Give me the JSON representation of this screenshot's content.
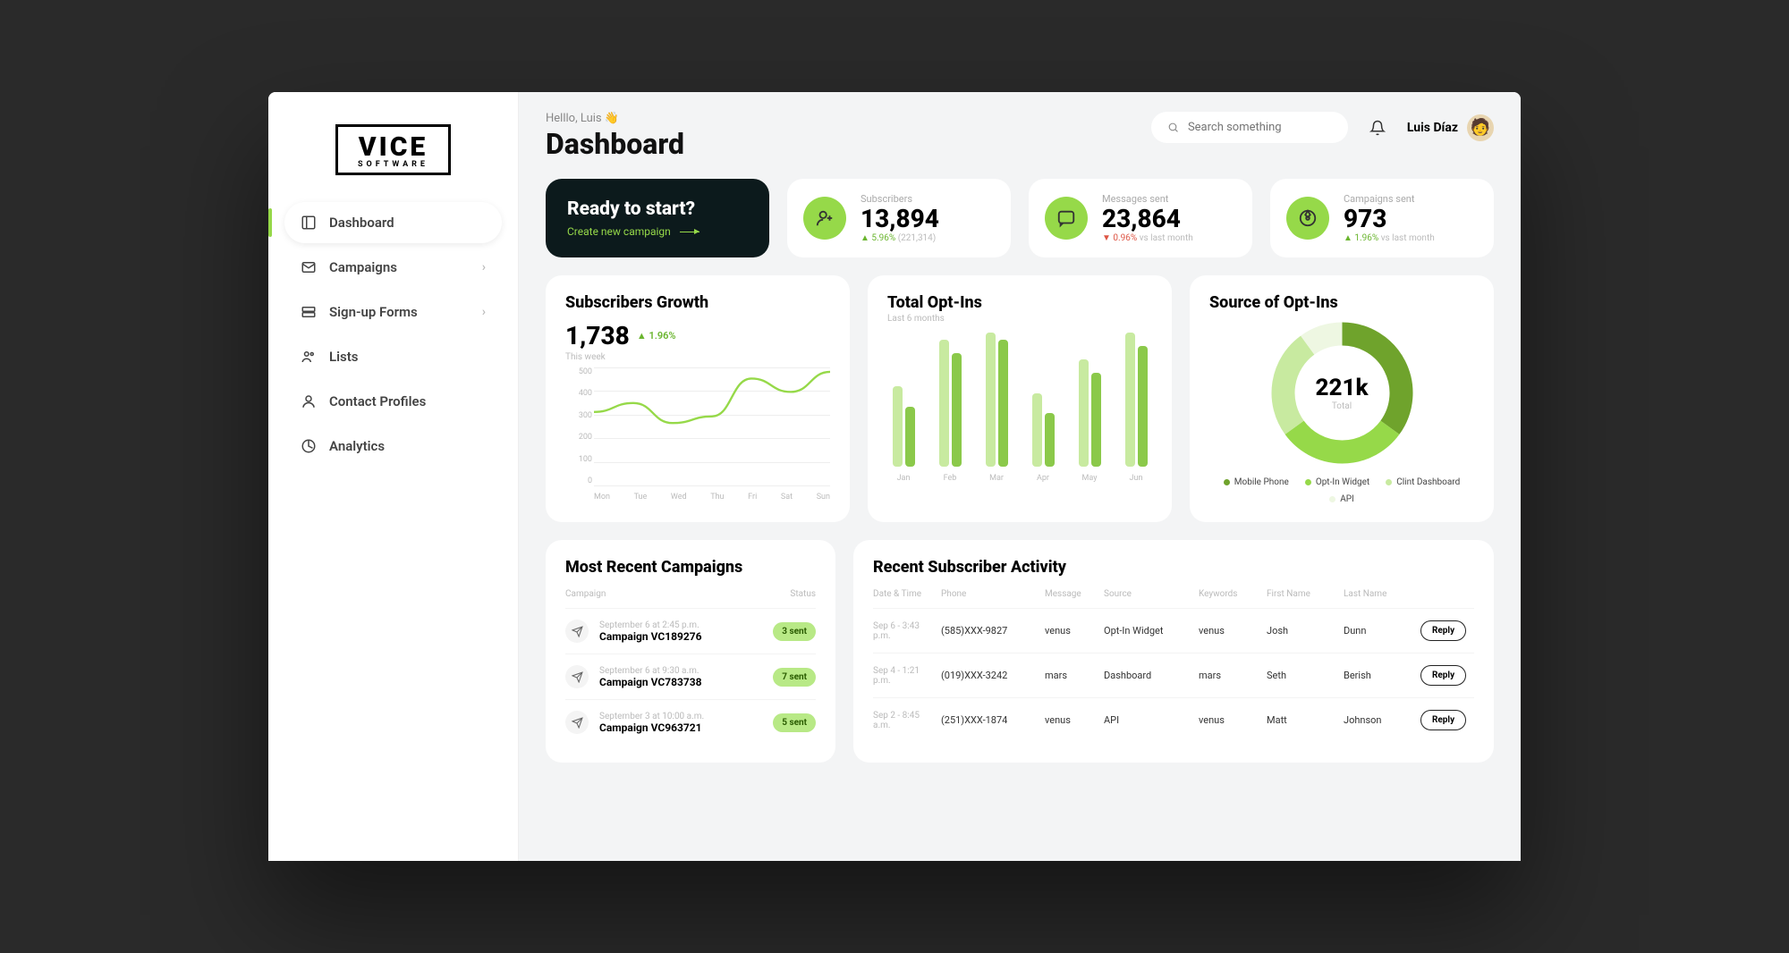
{
  "brand": {
    "main": "VICE",
    "sub": "SOFTWARE"
  },
  "nav": [
    {
      "label": "Dashboard",
      "active": true,
      "chevron": false
    },
    {
      "label": "Campaigns",
      "active": false,
      "chevron": true
    },
    {
      "label": "Sign-up Forms",
      "active": false,
      "chevron": true
    },
    {
      "label": "Lists",
      "active": false,
      "chevron": false
    },
    {
      "label": "Contact Profiles",
      "active": false,
      "chevron": false
    },
    {
      "label": "Analytics",
      "active": false,
      "chevron": false
    }
  ],
  "header": {
    "greeting": "Helllo, Luis 👋",
    "title": "Dashboard",
    "search_placeholder": "Search something",
    "user_name": "Luis Díaz"
  },
  "cta": {
    "title": "Ready to start?",
    "subtitle": "Create new campaign"
  },
  "stats": [
    {
      "label": "Subscribers",
      "value": "13,894",
      "delta": "5.96%",
      "dir": "up",
      "suffix": "(221,314)"
    },
    {
      "label": "Messages sent",
      "value": "23,864",
      "delta": "0.96%",
      "dir": "down",
      "suffix": "vs last month"
    },
    {
      "label": "Campaigns sent",
      "value": "973",
      "delta": "1.96%",
      "dir": "up",
      "suffix": "vs last month"
    }
  ],
  "growth": {
    "title": "Subscribers Growth",
    "value": "1,738",
    "delta": "1.96%",
    "sub": "This week"
  },
  "optins": {
    "title": "Total Opt-Ins",
    "sub": "Last 6 months"
  },
  "source": {
    "title": "Source of Opt-Ins",
    "center_value": "221k",
    "center_label": "Total",
    "legend": [
      {
        "label": "Mobile Phone",
        "color": "#6fa32c"
      },
      {
        "label": "Opt-In Widget",
        "color": "#96d949"
      },
      {
        "label": "Clint Dashboard",
        "color": "#c8eaa0"
      },
      {
        "label": "API",
        "color": "#eef7e2"
      }
    ]
  },
  "campaigns": {
    "title": "Most Recent Campaigns",
    "col1": "Campaign",
    "col2": "Status",
    "rows": [
      {
        "dt": "September 6 at 2:45 p.m.",
        "name": "Campaign VC189276",
        "status": "3 sent"
      },
      {
        "dt": "September 6 at 9:30 a.m.",
        "name": "Campaign VC783738",
        "status": "7 sent"
      },
      {
        "dt": "September 3 at 10:00 a.m.",
        "name": "Campaign VC963721",
        "status": "5 sent"
      }
    ]
  },
  "activity": {
    "title": "Recent Subscriber Activity",
    "cols": [
      "Date & Time",
      "Phone",
      "Message",
      "Source",
      "Keywords",
      "First Name",
      "Last Name",
      ""
    ],
    "reply_label": "Reply",
    "rows": [
      {
        "dt": "Sep 6 - 3:43 p.m.",
        "phone": "(585)XXX-9827",
        "msg": "venus",
        "src": "Opt-In Widget",
        "kw": "venus",
        "fn": "Josh",
        "ln": "Dunn"
      },
      {
        "dt": "Sep 4 - 1:21 p.m.",
        "phone": "(019)XXX-3242",
        "msg": "mars",
        "src": "Dashboard",
        "kw": "mars",
        "fn": "Seth",
        "ln": "Berish"
      },
      {
        "dt": "Sep 2 - 8:45 a.m.",
        "phone": "(251)XXX-1874",
        "msg": "venus",
        "src": "API",
        "kw": "venus",
        "fn": "Matt",
        "ln": "Johnson"
      }
    ]
  },
  "chart_data": [
    {
      "type": "line",
      "title": "Subscribers Growth",
      "categories": [
        "Mon",
        "Tue",
        "Wed",
        "Thu",
        "Fri",
        "Sat",
        "Sun"
      ],
      "values": [
        300,
        340,
        250,
        280,
        450,
        390,
        480
      ],
      "ylim": [
        0,
        500
      ],
      "yticks": [
        500,
        400,
        300,
        200,
        100,
        0
      ]
    },
    {
      "type": "bar",
      "title": "Total Opt-Ins",
      "categories": [
        "Jan",
        "Feb",
        "Mar",
        "Apr",
        "May",
        "Jun"
      ],
      "series": [
        {
          "name": "light",
          "color": "#c8eaa0",
          "values": [
            60,
            95,
            100,
            55,
            80,
            100
          ]
        },
        {
          "name": "dark",
          "color": "#8bc94a",
          "values": [
            45,
            85,
            95,
            40,
            70,
            90
          ]
        }
      ],
      "ylim": [
        0,
        100
      ]
    },
    {
      "type": "pie",
      "title": "Source of Opt-Ins",
      "categories": [
        "Mobile Phone",
        "Opt-In Widget",
        "Clint Dashboard",
        "API"
      ],
      "values": [
        35,
        30,
        25,
        10
      ],
      "colors": [
        "#6fa32c",
        "#96d949",
        "#c8eaa0",
        "#eef7e2"
      ]
    }
  ]
}
